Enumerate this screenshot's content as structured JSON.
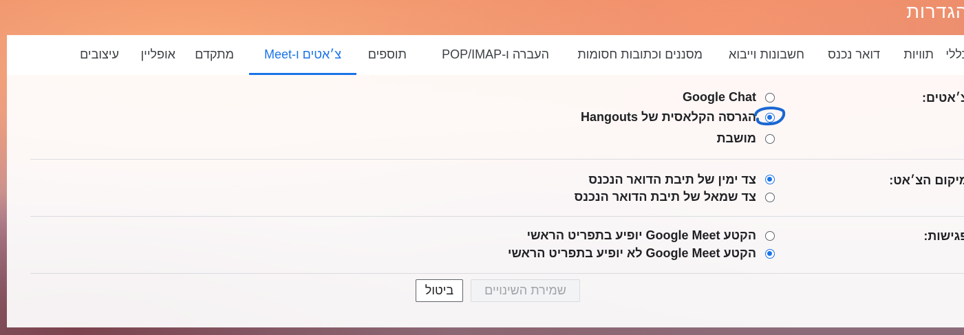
{
  "page": {
    "title": "הגדרות"
  },
  "tabs": [
    {
      "label": "כללי",
      "active": false
    },
    {
      "label": "תוויות",
      "active": false
    },
    {
      "label": "דואר נכנס",
      "active": false
    },
    {
      "label": "חשבונות וייבוא",
      "active": false
    },
    {
      "label": "מסננים וכתובות חסומות",
      "active": false
    },
    {
      "label": "העברה ו-POP/IMAP",
      "active": false
    },
    {
      "label": "תוספים",
      "active": false
    },
    {
      "label": "צ׳אטים ו-Meet",
      "active": true
    },
    {
      "label": "מתקדם",
      "active": false
    },
    {
      "label": "אופליין",
      "active": false
    },
    {
      "label": "עיצובים",
      "active": false
    }
  ],
  "chat": {
    "label": "צ׳אטים:",
    "options": [
      {
        "text": "Google Chat",
        "checked": false
      },
      {
        "text": "הגרסה הקלאסית של Hangouts",
        "checked": true
      },
      {
        "text": "מושבת",
        "checked": false
      }
    ]
  },
  "chat_position": {
    "label": "מיקום הצ׳אט:",
    "options": [
      {
        "text": "צד ימין של תיבת הדואר הנכנס",
        "checked": true
      },
      {
        "text": "צד שמאל של תיבת הדואר הנכנס",
        "checked": false
      }
    ]
  },
  "meetings": {
    "label": "פגישות:",
    "options": [
      {
        "text": "הקטע Google Meet יופיע בתפריט הראשי",
        "checked": false
      },
      {
        "text": "הקטע Google Meet לא יופיע בתפריט הראשי",
        "checked": true
      }
    ]
  },
  "buttons": {
    "save": "שמירת השינויים",
    "cancel": "ביטול"
  },
  "colors": {
    "accent": "#1a73e8",
    "text": "#202124",
    "annotation": "#1967d2"
  }
}
